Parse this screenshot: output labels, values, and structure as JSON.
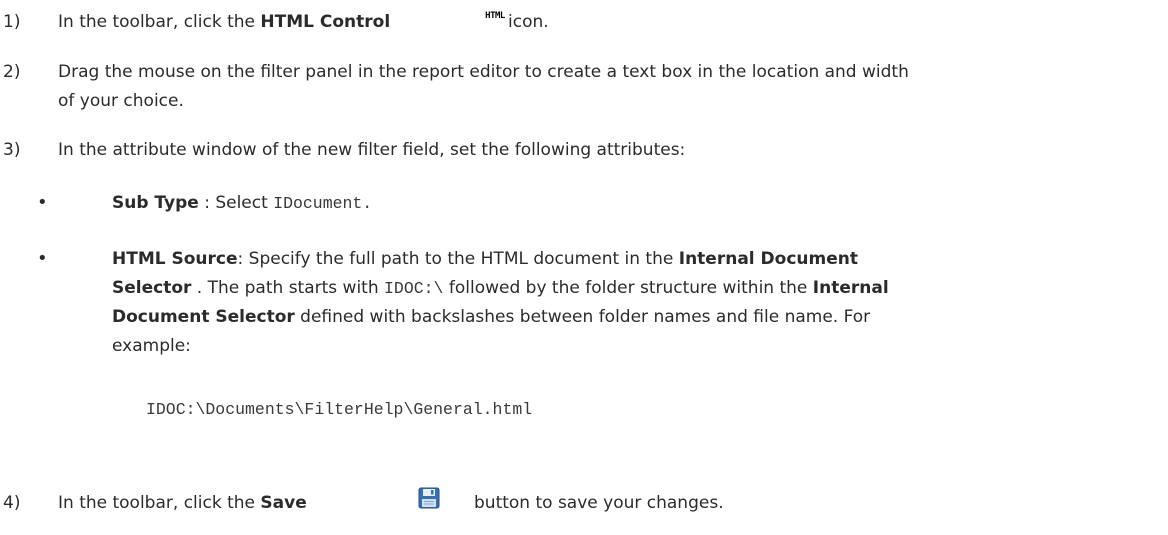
{
  "step1": {
    "num": "1)",
    "pre": "In the toolbar, click the ",
    "bold": "HTML Control",
    "icon_text": "HTML",
    "post": " icon."
  },
  "step2": {
    "num": "2)",
    "line1": "Drag the mouse on the filter panel in the report editor to create a text box in the location and width",
    "line2": "of your choice."
  },
  "step3": {
    "num": "3)",
    "text": "In the attribute window of the new filter field, set the following attributes:"
  },
  "bullet1": {
    "bullet": "•",
    "bold": "Sub Type",
    "mid": " : Select ",
    "code": "IDocument."
  },
  "bullet2": {
    "bullet": "•",
    "bold1": "HTML Source",
    "t1": ": Specify the full path to the HTML document in the ",
    "bold2": "Internal Document",
    "bold3": "Selector",
    "t2": " . The path starts with ",
    "code1": "IDOC:\\",
    "t3": " followed by the folder structure within the ",
    "bold4": "Internal",
    "bold5": "Document Selector",
    "t4": " defined with backslashes between folder names and file name. For",
    "t5": "example:",
    "example": "IDOC:\\Documents\\FilterHelp\\General.html"
  },
  "step4": {
    "num": "4)",
    "pre": "In the toolbar, click the ",
    "bold": "Save",
    "post": "button to save your changes."
  },
  "colors": {
    "text": "#2b2b2b",
    "save_icon_blue": "#3a6fb0"
  }
}
